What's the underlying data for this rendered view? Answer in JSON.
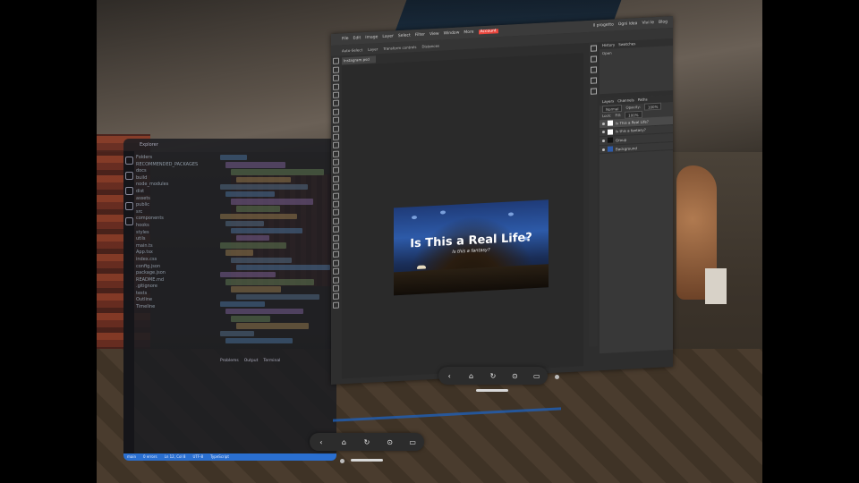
{
  "editor": {
    "title": "Explorer",
    "tree": [
      "Folders",
      "RECOMMENDED_PACKAGES",
      "docs",
      "build",
      "node_modules",
      "dist",
      "assets",
      "public",
      "src",
      "components",
      "hooks",
      "styles",
      "utils",
      "main.ts",
      "App.tsx",
      "index.css",
      "config.json",
      "package.json",
      "README.md",
      ".gitignore",
      "tests",
      "Outline",
      "Timeline"
    ],
    "tabs": [
      "Problems",
      "Output",
      "Terminal"
    ],
    "status": [
      "main",
      "0 errors",
      "Ln 12, Col 8",
      "UTF-8",
      "TypeScript"
    ]
  },
  "photoeditor": {
    "menu": [
      "File",
      "Edit",
      "Image",
      "Layer",
      "Select",
      "Filter",
      "View",
      "Window",
      "More"
    ],
    "menu_highlight": "Account",
    "right_menu": [
      "Il progetto",
      "Ogni idea",
      "Vivi le",
      "Blog"
    ],
    "options": [
      "Auto-Select",
      "Layer",
      "Transform controls",
      "Distances"
    ],
    "doc_tab": "Instagram.psd",
    "artwork": {
      "title": "Is This a Real Life?",
      "subtitle": "Is this a fantasy?"
    },
    "history_tabs": [
      "History",
      "Swatches"
    ],
    "history_item": "Open",
    "layers_tabs": [
      "Layers",
      "Channels",
      "Paths"
    ],
    "blend_mode": "Normal",
    "opacity_label": "Opacity:",
    "opacity_value": "100%",
    "fill_label": "Fill:",
    "fill_value": "100%",
    "lock_label": "Lock:",
    "layers": [
      "Is This a Real Life?",
      "Is this a fantasy?",
      "Group",
      "Background"
    ]
  },
  "ctrlbar": {
    "icons": [
      "back-icon",
      "home-icon",
      "reload-icon",
      "settings-icon",
      "cast-icon"
    ],
    "glyphs": [
      "‹",
      "⌂",
      "↻",
      "⊙",
      "▭"
    ]
  },
  "colors": {
    "accent": "#e8453c",
    "status_blue": "#2a6fd0"
  }
}
